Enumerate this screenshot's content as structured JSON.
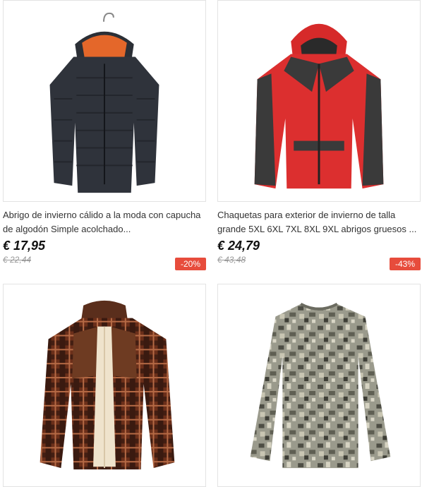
{
  "products": [
    {
      "title": "Abrigo de invierno cálido a la moda con capucha de algodón Simple acolchado...",
      "price": "€ 17,95",
      "old_price": "€ 22,44",
      "discount": "-20%",
      "image_icon": "black-puffer-jacket-image"
    },
    {
      "title": "Chaquetas para exterior de invierno de talla grande 5XL 6XL 7XL 8XL 9XL abrigos gruesos ...",
      "price": "€ 24,79",
      "old_price": "€ 43,48",
      "discount": "-43%",
      "image_icon": "red-hooded-jacket-image"
    },
    {
      "image_icon": "plaid-fleece-jacket-image"
    },
    {
      "image_icon": "camo-longsleeve-shirt-image"
    }
  ],
  "colors": {
    "discount_badge": "#e74c3c",
    "card_border": "#e3e3e3"
  }
}
